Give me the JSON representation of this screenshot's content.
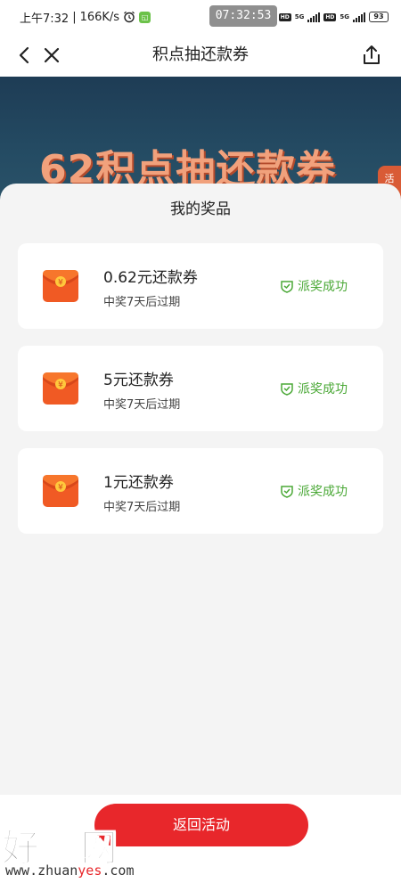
{
  "status_bar": {
    "time": "上午7:32",
    "network_speed": "166K/s",
    "clock_overlay": "07:32:53",
    "hd1": "HD",
    "net1": "5G",
    "hd2": "HD",
    "net2": "5G",
    "battery": "93"
  },
  "nav": {
    "title": "积点抽还款券"
  },
  "banner": {
    "title": "62积点抽还款券",
    "side_tab": "活"
  },
  "sheet": {
    "title": "我的奖品",
    "prizes": [
      {
        "name": "0.62元还款券",
        "expiry": "中奖7天后过期",
        "status": "派奖成功"
      },
      {
        "name": "5元还款券",
        "expiry": "中奖7天后过期",
        "status": "派奖成功"
      },
      {
        "name": "1元还款券",
        "expiry": "中奖7天后过期",
        "status": "派奖成功"
      }
    ],
    "envelope_symbol": "¥"
  },
  "bottom": {
    "return_label": "返回活动"
  },
  "watermark": {
    "text": "好赚网",
    "url_prefix": "www.zhuan",
    "url_highlight": "yes",
    "url_suffix": ".com"
  },
  "colors": {
    "accent_red": "#e8272b",
    "success_green": "#4aa836",
    "banner_bg": "#244b63"
  }
}
